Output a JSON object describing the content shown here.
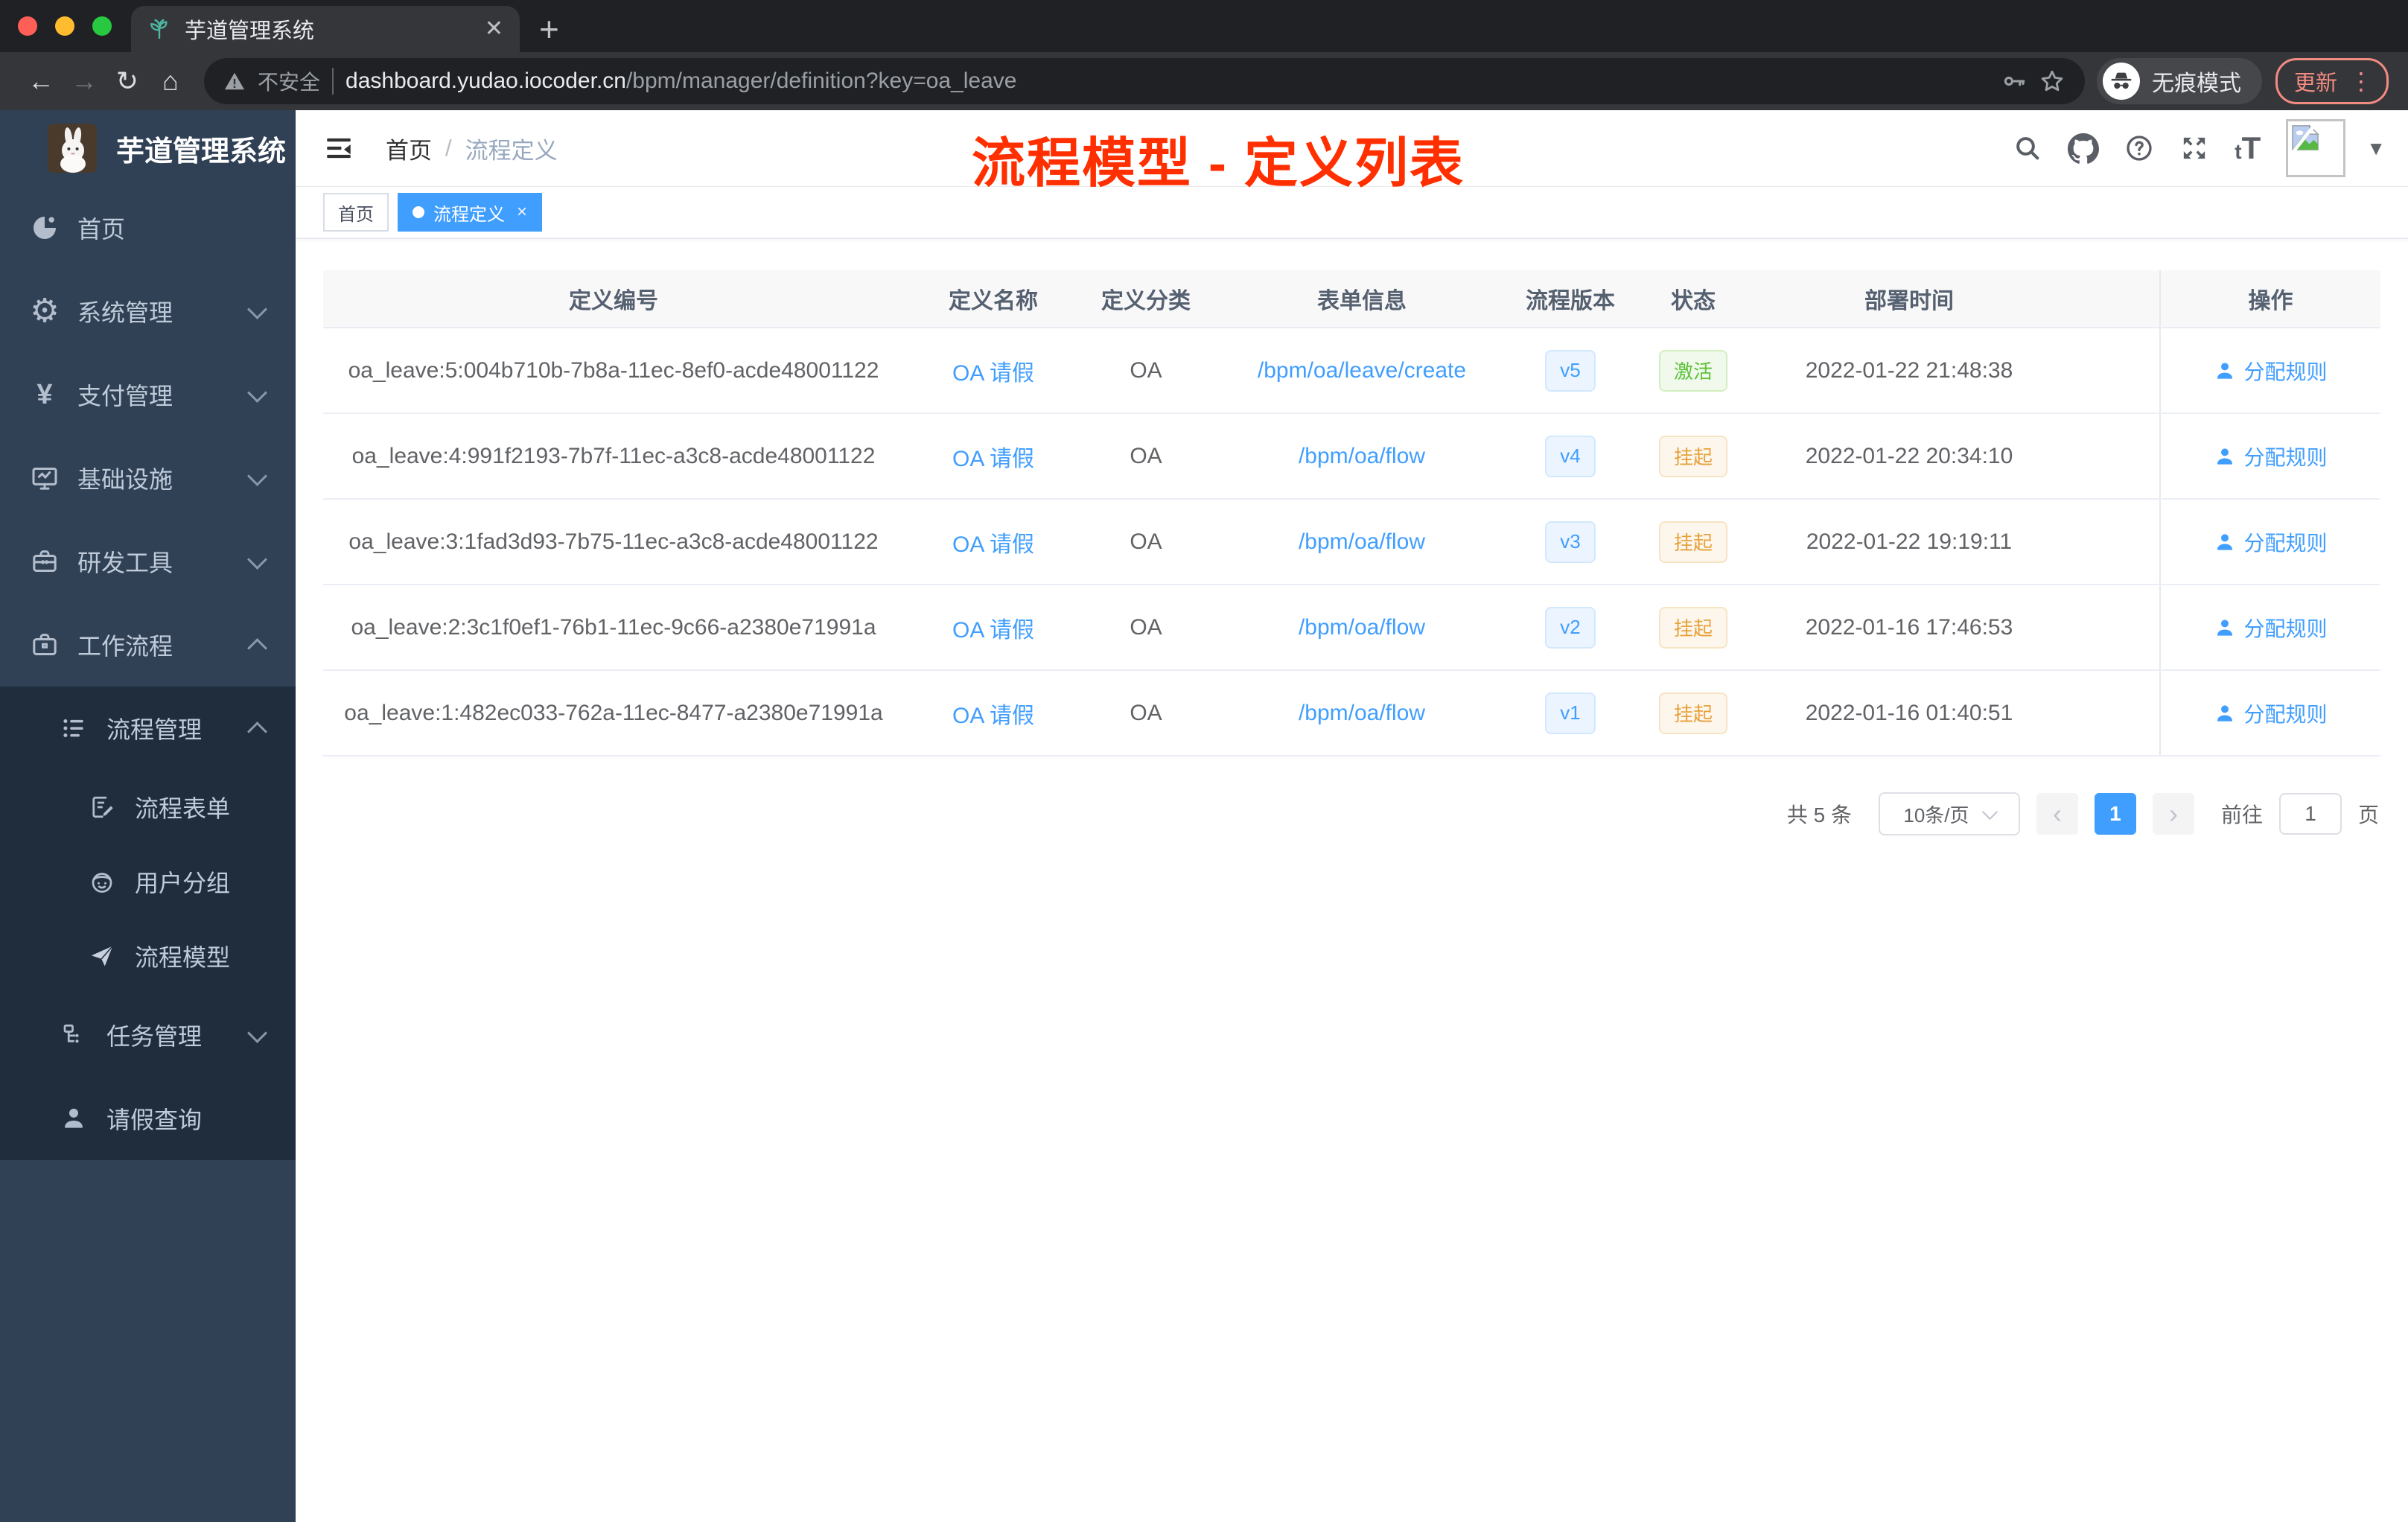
{
  "colors": {
    "accent": "#409EFF",
    "success": "#5DC23A",
    "warning": "#E6A23C",
    "annotation_red": "#FF2F00",
    "sidebar_bg": "#304156",
    "submenu_bg": "#1F2D3D",
    "chrome_dark": "#202124",
    "chrome_light": "#35363A",
    "update_pill": "#F28B82"
  },
  "browser": {
    "tab_title": "芋道管理系统",
    "tab_close": "✕",
    "new_tab": "+",
    "security_label": "不安全",
    "url_domain": "dashboard.yudao.iocoder.cn",
    "url_path": "/bpm/manager/definition?key=oa_leave",
    "incognito_label": "无痕模式",
    "update_label": "更新",
    "menu_dots": "⋮",
    "back": "←",
    "forward": "→",
    "reload": "↻",
    "home": "⌂"
  },
  "sidebar": {
    "app_title": "芋道管理系统",
    "home": "首页",
    "system": "系统管理",
    "payment": "支付管理",
    "infra": "基础设施",
    "devtools": "研发工具",
    "workflow": "工作流程",
    "process_mgmt": "流程管理",
    "process_form": "流程表单",
    "user_group": "用户分组",
    "process_model": "流程模型",
    "task_mgmt": "任务管理",
    "leave_query": "请假查询",
    "yen_glyph": "¥",
    "gear_glyph": "⚙"
  },
  "navbar": {
    "breadcrumb_home": "首页",
    "breadcrumb_sep": "/",
    "breadcrumb_current": "流程定义",
    "annotation": "流程模型 - 定义列表",
    "font_small": "t",
    "font_big": "T",
    "caret": "▼"
  },
  "tags": {
    "home": "首页",
    "current": "流程定义",
    "close": "×"
  },
  "table": {
    "columns": [
      "定义编号",
      "定义名称",
      "定义分类",
      "表单信息",
      "流程版本",
      "状态",
      "部署时间",
      "操作"
    ],
    "rows": [
      {
        "id": "oa_leave:5:004b710b-7b8a-11ec-8ef0-acde48001122",
        "name": "OA 请假",
        "category": "OA",
        "form": "/bpm/oa/leave/create",
        "version": "v5",
        "status": "激活",
        "time": "2022-01-22 21:48:38",
        "action": "分配规则"
      },
      {
        "id": "oa_leave:4:991f2193-7b7f-11ec-a3c8-acde48001122",
        "name": "OA 请假",
        "category": "OA",
        "form": "/bpm/oa/flow",
        "version": "v4",
        "status": "挂起",
        "time": "2022-01-22 20:34:10",
        "action": "分配规则"
      },
      {
        "id": "oa_leave:3:1fad3d93-7b75-11ec-a3c8-acde48001122",
        "name": "OA 请假",
        "category": "OA",
        "form": "/bpm/oa/flow",
        "version": "v3",
        "status": "挂起",
        "time": "2022-01-22 19:19:11",
        "action": "分配规则"
      },
      {
        "id": "oa_leave:2:3c1f0ef1-76b1-11ec-9c66-a2380e71991a",
        "name": "OA 请假",
        "category": "OA",
        "form": "/bpm/oa/flow",
        "version": "v2",
        "status": "挂起",
        "time": "2022-01-16 17:46:53",
        "action": "分配规则"
      },
      {
        "id": "oa_leave:1:482ec033-762a-11ec-8477-a2380e71991a",
        "name": "OA 请假",
        "category": "OA",
        "form": "/bpm/oa/flow",
        "version": "v1",
        "status": "挂起",
        "time": "2022-01-16 01:40:51",
        "action": "分配规则"
      }
    ]
  },
  "pagination": {
    "total": "共 5 条",
    "page_size": "10条/页",
    "prev": "‹",
    "current": "1",
    "next": "›",
    "goto_label": "前往",
    "goto_value": "1",
    "unit": "页"
  }
}
